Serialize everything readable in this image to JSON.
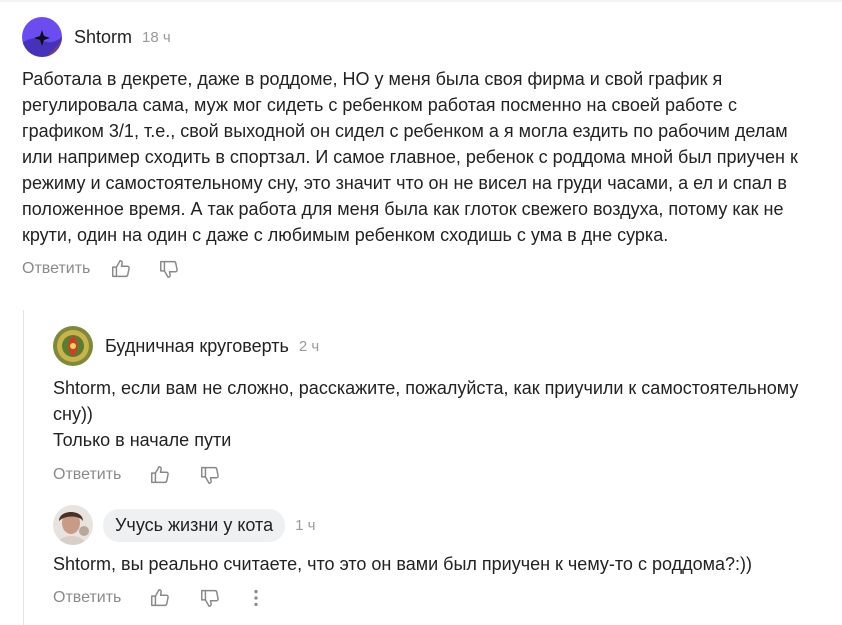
{
  "comments": [
    {
      "author": "Shtorm",
      "time": "18 ч",
      "text": "Работала в декрете, даже в роддоме, НО у меня была своя фирма и свой график я регулировала сама, муж мог сидеть с ребенком работая посменно на своей работе с графиком 3/1, т.е., свой выходной он сидел с ребенком а я могла ездить по рабочим делам или например сходить в спортзал. И самое главное, ребенок с роддома мной был приучен к режиму и самостоятельному сну, это значит что он не висел на груди часами, а ел и спал в положенное время. А так работа для меня была как глоток свежего воздуха, потому как не крути, один на один с даже с любимым ребенком сходишь с ума в дне сурка.",
      "reply_label": "Ответить"
    },
    {
      "author": "Будничная круговерть",
      "time": "2 ч",
      "text": "Shtorm, если вам не сложно, расскажите, пожалуйста, как приучили к самостоятельному сну))\nТолько в начале пути",
      "reply_label": "Ответить"
    },
    {
      "author": "Учусь жизни у кота",
      "time": "1 ч",
      "text": "Shtorm, вы реально считаете, что это он вами был приучен к чему-то с роддома?:))",
      "reply_label": "Ответить"
    }
  ],
  "icons": {
    "like": "thumbs-up-icon",
    "dislike": "thumbs-down-icon",
    "more": "more-vertical-icon"
  },
  "colors": {
    "avatar_1": "#6a4cf0",
    "avatar_1_accent": "#ff7a2f",
    "pill_bg": "#eef0f2"
  }
}
